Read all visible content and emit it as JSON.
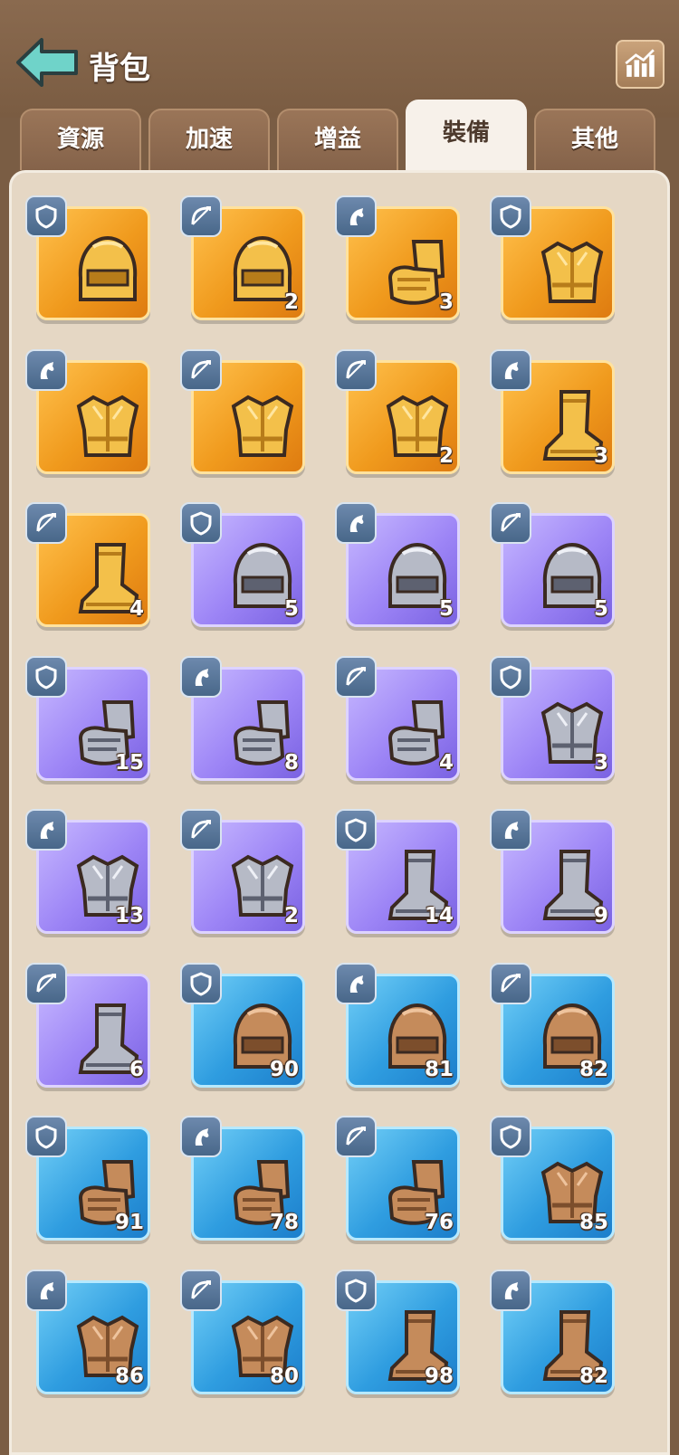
{
  "header": {
    "title": "背包",
    "back_icon": "back-arrow-icon",
    "stats_icon": "bar-chart-icon"
  },
  "tabs": [
    {
      "label": "資源",
      "active": false
    },
    {
      "label": "加速",
      "active": false
    },
    {
      "label": "增益",
      "active": false
    },
    {
      "label": "裝備",
      "active": true
    },
    {
      "label": "其他",
      "active": false
    }
  ],
  "items": [
    {
      "rarity": "gold",
      "type": "shield",
      "icon": "helmet-icon",
      "count": ""
    },
    {
      "rarity": "gold",
      "type": "bow",
      "icon": "helmet-icon",
      "count": "2"
    },
    {
      "rarity": "gold",
      "type": "horse",
      "icon": "gauntlet-icon",
      "count": "3"
    },
    {
      "rarity": "gold",
      "type": "shield",
      "icon": "chest-armor-icon",
      "count": ""
    },
    {
      "rarity": "gold",
      "type": "horse",
      "icon": "chest-armor-icon",
      "count": ""
    },
    {
      "rarity": "gold",
      "type": "bow",
      "icon": "chest-armor-icon",
      "count": ""
    },
    {
      "rarity": "gold",
      "type": "bow",
      "icon": "chest-armor-icon",
      "count": "2"
    },
    {
      "rarity": "gold",
      "type": "horse",
      "icon": "boot-icon",
      "count": "3"
    },
    {
      "rarity": "gold",
      "type": "bow",
      "icon": "boot-icon",
      "count": "4"
    },
    {
      "rarity": "purple",
      "type": "shield",
      "icon": "helmet-icon",
      "count": "5"
    },
    {
      "rarity": "purple",
      "type": "horse",
      "icon": "helmet-icon",
      "count": "5"
    },
    {
      "rarity": "purple",
      "type": "bow",
      "icon": "helmet-icon",
      "count": "5"
    },
    {
      "rarity": "purple",
      "type": "shield",
      "icon": "gauntlet-icon",
      "count": "15"
    },
    {
      "rarity": "purple",
      "type": "horse",
      "icon": "gauntlet-icon",
      "count": "8"
    },
    {
      "rarity": "purple",
      "type": "bow",
      "icon": "gauntlet-icon",
      "count": "4"
    },
    {
      "rarity": "purple",
      "type": "shield",
      "icon": "chest-armor-icon",
      "count": "3"
    },
    {
      "rarity": "purple",
      "type": "horse",
      "icon": "chest-armor-icon",
      "count": "13"
    },
    {
      "rarity": "purple",
      "type": "bow",
      "icon": "chest-armor-icon",
      "count": "2"
    },
    {
      "rarity": "purple",
      "type": "shield",
      "icon": "boot-icon",
      "count": "14"
    },
    {
      "rarity": "purple",
      "type": "horse",
      "icon": "boot-icon",
      "count": "9"
    },
    {
      "rarity": "purple",
      "type": "bow",
      "icon": "boot-icon",
      "count": "6"
    },
    {
      "rarity": "blue",
      "type": "shield",
      "icon": "helmet-icon",
      "count": "90"
    },
    {
      "rarity": "blue",
      "type": "horse",
      "icon": "helmet-icon",
      "count": "81"
    },
    {
      "rarity": "blue",
      "type": "bow",
      "icon": "helmet-icon",
      "count": "82"
    },
    {
      "rarity": "blue",
      "type": "shield",
      "icon": "gauntlet-icon",
      "count": "91"
    },
    {
      "rarity": "blue",
      "type": "horse",
      "icon": "gauntlet-icon",
      "count": "78"
    },
    {
      "rarity": "blue",
      "type": "bow",
      "icon": "gauntlet-icon",
      "count": "76"
    },
    {
      "rarity": "blue",
      "type": "shield",
      "icon": "chest-armor-icon",
      "count": "85"
    },
    {
      "rarity": "blue",
      "type": "horse",
      "icon": "chest-armor-icon",
      "count": "86"
    },
    {
      "rarity": "blue",
      "type": "bow",
      "icon": "chest-armor-icon",
      "count": "80"
    },
    {
      "rarity": "blue",
      "type": "shield",
      "icon": "boot-icon",
      "count": "98"
    },
    {
      "rarity": "blue",
      "type": "horse",
      "icon": "boot-icon",
      "count": "82"
    }
  ]
}
